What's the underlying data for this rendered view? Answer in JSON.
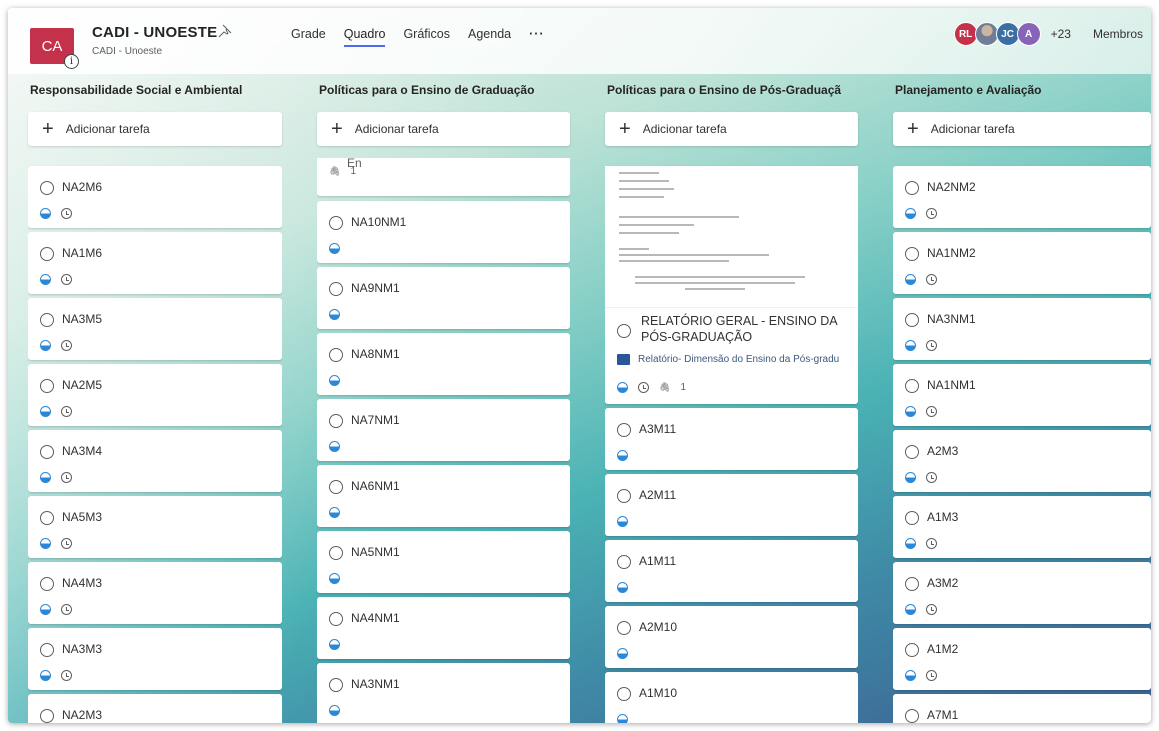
{
  "plan": {
    "logo_initials": "CA",
    "title": "CADI - UNOESTE",
    "subtitle": "CADI - Unoeste",
    "info_badge": "i",
    "pin_icon": "pin-icon"
  },
  "nav": {
    "tabs": [
      {
        "label": "Grade"
      },
      {
        "label": "Quadro",
        "active": true
      },
      {
        "label": "Gráficos"
      },
      {
        "label": "Agenda"
      }
    ],
    "more": "···"
  },
  "members": {
    "avatars": [
      {
        "initials": "RL",
        "color": "#c4314b"
      },
      {
        "initials": "",
        "color": "#6f7e96",
        "photo": true
      },
      {
        "initials": "JC",
        "color": "#3b6fa4"
      },
      {
        "initials": "A",
        "color": "#8764b8"
      }
    ],
    "count": "+23",
    "label": "Membros"
  },
  "add_task_label": "Adicionar tarefa",
  "buckets": [
    {
      "title": "Responsabilidade Social e Ambiental",
      "cards": [
        {
          "title": "NA2M6",
          "date": true
        },
        {
          "title": "NA1M6",
          "date": true
        },
        {
          "title": "NA3M5",
          "date": true
        },
        {
          "title": "NA2M5",
          "date": true
        },
        {
          "title": "NA3M4",
          "date": true
        },
        {
          "title": "NA5M3",
          "date": true
        },
        {
          "title": "NA4M3",
          "date": true
        },
        {
          "title": "NA3M3",
          "date": true
        },
        {
          "title": "NA2M3",
          "date": true
        }
      ]
    },
    {
      "title": "Políticas para o Ensino de Graduação",
      "partial": {
        "title": "Modelo de Planilha de Acompanhamento En",
        "attachments": "1"
      },
      "cards": [
        {
          "title": "NA10NM1"
        },
        {
          "title": "NA9NM1"
        },
        {
          "title": "NA8NM1"
        },
        {
          "title": "NA7NM1"
        },
        {
          "title": "NA6NM1"
        },
        {
          "title": "NA5NM1"
        },
        {
          "title": "NA4NM1"
        },
        {
          "title": "NA3NM1"
        }
      ]
    },
    {
      "title": "Políticas para o Ensino de Pós-Graduaçã",
      "big": {
        "title": "RELATÓRIO GERAL - ENSINO DA PÓS-GRADUAÇÃO",
        "attachment": "Relatório- Dimensão do Ensino da Pós-gradu",
        "attachments": "1"
      },
      "cards": [
        {
          "title": "A3M11"
        },
        {
          "title": "A2M11"
        },
        {
          "title": "A1M11"
        },
        {
          "title": "A2M10"
        },
        {
          "title": "A1M10"
        }
      ]
    },
    {
      "title": "Planejamento e Avaliação",
      "cards": [
        {
          "title": "NA2NM2",
          "date": true
        },
        {
          "title": "NA1NM2",
          "date": true
        },
        {
          "title": "NA3NM1",
          "date": true
        },
        {
          "title": "NA1NM1",
          "date": true
        },
        {
          "title": "A2M3",
          "date": true
        },
        {
          "title": "A1M3",
          "date": true
        },
        {
          "title": "A3M2",
          "date": true
        },
        {
          "title": "A1M2",
          "date": true
        },
        {
          "title": "A7M1",
          "date": true
        }
      ]
    }
  ]
}
